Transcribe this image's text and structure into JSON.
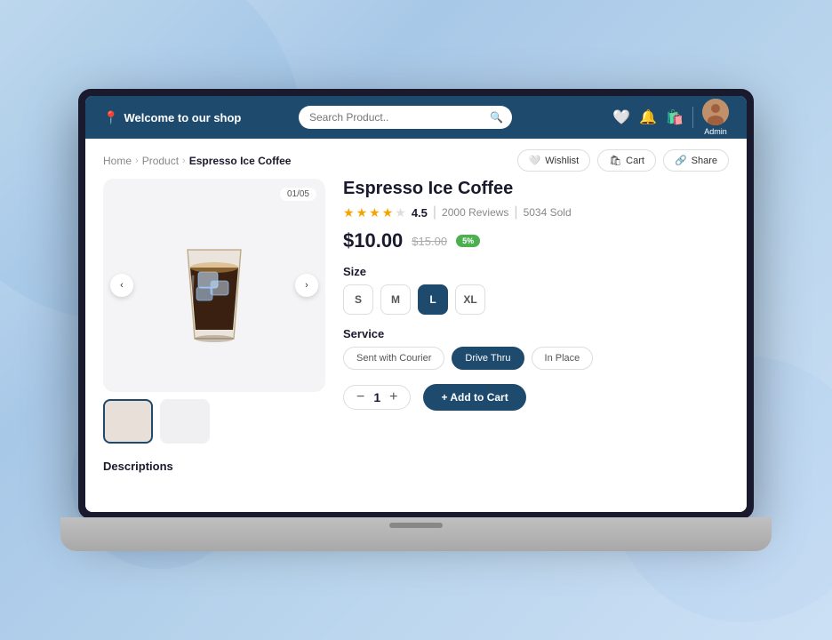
{
  "background": {
    "colors": [
      "#c8dff0",
      "#a8c8e8"
    ]
  },
  "nav": {
    "brand_label": "Welcome to our shop",
    "brand_icon": "📍",
    "search_placeholder": "Search Product..",
    "avatar_label": "Admin"
  },
  "breadcrumb": {
    "home": "Home",
    "product": "Product",
    "current": "Espresso Ice Coffee"
  },
  "action_buttons": {
    "wishlist": "Wishlist",
    "cart": "Cart",
    "share": "Share"
  },
  "product": {
    "title": "Espresso Ice Coffee",
    "rating": "4.5",
    "reviews": "2000 Reviews",
    "sold": "5034 Sold",
    "price": "$10.00",
    "price_original": "$15.00",
    "sale_badge": "5%",
    "image_counter": "01/05",
    "size_label": "Size",
    "sizes": [
      "S",
      "M",
      "L",
      "XL"
    ],
    "active_size": "L",
    "service_label": "Service",
    "services": [
      "Sent with Courier",
      "Drive Thru",
      "In Place"
    ],
    "active_service": "Drive Thru",
    "quantity": "1",
    "add_to_cart_label": "+ Add to Cart",
    "descriptions_label": "Descriptions"
  }
}
